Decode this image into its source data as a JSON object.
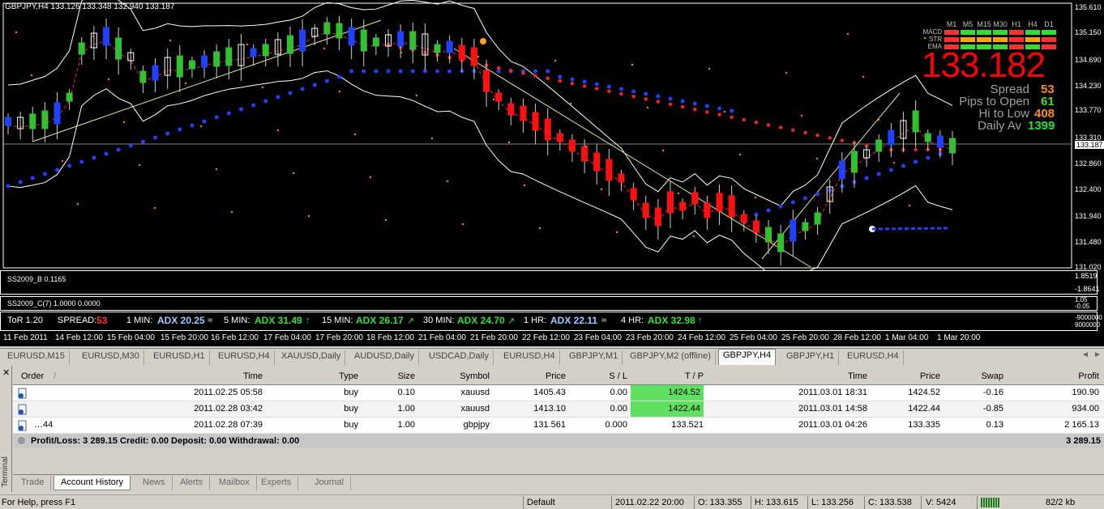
{
  "chart": {
    "title": "GBPJPY,H4  133.126 133.348 132.940 133.187",
    "price_scale": [
      "135.610",
      "135.150",
      "134.690",
      "134.230",
      "133.770",
      "133.310",
      "133.187",
      "132.860",
      "132.400",
      "131.940",
      "131.480",
      "131.020"
    ],
    "ind1_label": "SS2009_B 0.1165",
    "ind1_scale": [
      "1.8519",
      "-1.8641"
    ],
    "ind2_label": "SS2009_C(7) 1.0000 0.0000",
    "ind2_scale": [
      "1.05",
      "-0.05"
    ],
    "adx_scale": [
      "-9000000",
      "9000000"
    ],
    "dates": [
      "11 Feb 2011",
      "14 Feb 12:00",
      "15 Feb 04:00",
      "15 Feb 20:00",
      "16 Feb 12:00",
      "17 Feb 04:00",
      "17 Feb 20:00",
      "18 Feb 12:00",
      "21 Feb 04:00",
      "21 Feb 20:00",
      "22 Feb 12:00",
      "23 Feb 04:00",
      "23 Feb 20:00",
      "24 Feb 12:00",
      "25 Feb 04:00",
      "25 Feb 20:00",
      "28 Feb 12:00",
      "1 Mar 04:00",
      "1 Mar 20:00"
    ]
  },
  "hud": {
    "timeframes": [
      "M1",
      "M5",
      "M15",
      "M30",
      "H1",
      "H4",
      "D1"
    ],
    "rows": [
      "MACD",
      "STR",
      "EMA"
    ],
    "cells": [
      [
        "#ff3030",
        "#30e030",
        "#30e030",
        "#30e030",
        "#ff3030",
        "#30e030",
        "#30e030"
      ],
      [
        "#ff3030",
        "#ffa020",
        "#ffa020",
        "#ffa020",
        "#ff3030",
        "#ffa020",
        "#ff3030"
      ],
      [
        "#ff3030",
        "#30e030",
        "#30e030",
        "#30e030",
        "#ff3030",
        "#30e030",
        "#ff3030"
      ]
    ],
    "big_price": "133.182",
    "spread_label": "Spread",
    "spread_value": "53",
    "pips_label": "Pips to Open",
    "pips_value": "61",
    "hilo_label": "Hi to Low",
    "hilo_value": "408",
    "daily_label": "Daily Av",
    "daily_value": "1399"
  },
  "adx": {
    "tor": "ToR 1.20",
    "spread_label": "SPREAD:",
    "spread_value": "53",
    "m1_label": "1 MIN:",
    "m1_value": "ADX 20.25",
    "m5_label": "5 MIN:",
    "m5_value": "ADX 31.49",
    "m15_label": "15 MIN:",
    "m15_value": "ADX 26.17",
    "m30_label": "30 MIN:",
    "m30_value": "ADX 24.70",
    "h1_label": "1 HR:",
    "h1_value": "ADX 22.11",
    "h4_label": "4 HR:",
    "h4_value": "ADX 32.98"
  },
  "symbol_tabs": [
    "EURUSD,M15",
    "EURUSD,M30",
    "EURUSD,H1",
    "EURUSD,H4",
    "XAUUSD,Daily",
    "AUDUSD,Daily",
    "USDCAD,Daily",
    "EURUSD,H4",
    "GBPJPY,M1",
    "GBPJPY,M2 (offline)",
    "GBPJPY,H4",
    "GBPJPY,H1",
    "EURUSD,H4"
  ],
  "active_tab": "GBPJPY,H4",
  "table": {
    "headers": [
      "Order",
      "Time",
      "Type",
      "Size",
      "Symbol",
      "Price",
      "S / L",
      "T / P",
      "Time",
      "Price",
      "Swap",
      "Profit"
    ],
    "rows": [
      [
        "",
        "2011.02.25 05:58",
        "buy",
        "0.10",
        "xauusd",
        "1405.43",
        "0.00",
        "1424.52",
        "2011.03.01 18:31",
        "1424.52",
        "-0.16",
        "190.90"
      ],
      [
        "",
        "2011.02.28 03:42",
        "buy",
        "1.00",
        "xauusd",
        "1413.10",
        "0.00",
        "1422.44",
        "2011.03.01 14:58",
        "1422.44",
        "-0.85",
        "934.00"
      ],
      [
        "…44",
        "2011.02.28 07:39",
        "buy",
        "1.00",
        "gbpjpy",
        "131.561",
        "0.000",
        "133.521",
        "2011.03.01 04:26",
        "133.335",
        "0.13",
        "2 165.13"
      ]
    ],
    "summary": "Profit/Loss: 3 289.15  Credit: 0.00  Deposit: 0.00  Withdrawal: 0.00",
    "summary_total": "3 289.15"
  },
  "terminal_label": "Terminal",
  "bottom_tabs": [
    "Trade",
    "Account History",
    "News",
    "Alerts",
    "Mailbox",
    "Experts",
    "Journal"
  ],
  "active_bottom_tab": "Account History",
  "status": {
    "help": "For Help, press F1",
    "profile": "Default",
    "datetime": "2011.02.22 20:00",
    "open": "O: 133.355",
    "high": "H: 133.615",
    "low": "L: 133.256",
    "close": "C: 133.538",
    "volume": "V: 5424",
    "traffic": "82/2 kb"
  }
}
